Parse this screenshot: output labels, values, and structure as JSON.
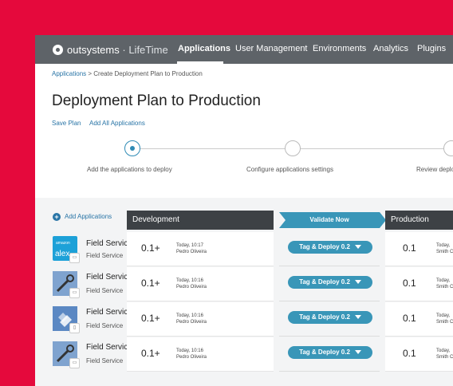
{
  "nav": {
    "logo_brand": "outsystems",
    "logo_product": "LifeTime",
    "items": [
      "Applications",
      "User Management",
      "Environments",
      "Analytics",
      "Plugins"
    ]
  },
  "breadcrumb": {
    "root": "Applications",
    "current": "> Create Deployment Plan to Production"
  },
  "title": "Deployment Plan to Production",
  "actions": {
    "save": "Save Plan",
    "add_all": "Add All Applications"
  },
  "steps": [
    "Add the applications to deploy",
    "Configure applications settings",
    "Review deployment"
  ],
  "add_applications": "Add Applications",
  "columns": {
    "development": "Development",
    "validate": "Validate Now",
    "production": "Production"
  },
  "rows": [
    {
      "name": "Field Service",
      "sub": "Field Service",
      "icon": "alexa-icon",
      "dev_version": "0.1+",
      "dev_time": "Today, 10:17",
      "dev_user": "Pedro Oliveira",
      "button": "Tag & Deploy 0.2",
      "prod_version": "0.1",
      "prod_time": "Today,",
      "prod_user": "Smith C"
    },
    {
      "name": "Field Service",
      "sub": "Field Service",
      "icon": "wrench-icon",
      "dev_version": "0.1+",
      "dev_time": "Today, 10:16",
      "dev_user": "Pedro Oliveira",
      "button": "Tag & Deploy 0.2",
      "prod_version": "0.1",
      "prod_time": "Today,",
      "prod_user": "Smith C"
    },
    {
      "name": "Field Service",
      "sub": "Field Service",
      "icon": "document-icon",
      "dev_version": "0.1+",
      "dev_time": "Today, 10:16",
      "dev_user": "Pedro Oliveira",
      "button": "Tag & Deploy 0.2",
      "prod_version": "0.1",
      "prod_time": "Today,",
      "prod_user": "Smith C"
    },
    {
      "name": "Field Service",
      "sub": "Field Service",
      "icon": "wrench-icon",
      "dev_version": "0.1+",
      "dev_time": "Today, 10:16",
      "dev_user": "Pedro Oliveira",
      "button": "Tag & Deploy 0.2",
      "prod_version": "0.1",
      "prod_time": "Today,",
      "prod_user": "Smith C"
    }
  ],
  "colors": {
    "accent": "#3996b8",
    "background": "#e5093c",
    "nav": "#5e6368"
  }
}
